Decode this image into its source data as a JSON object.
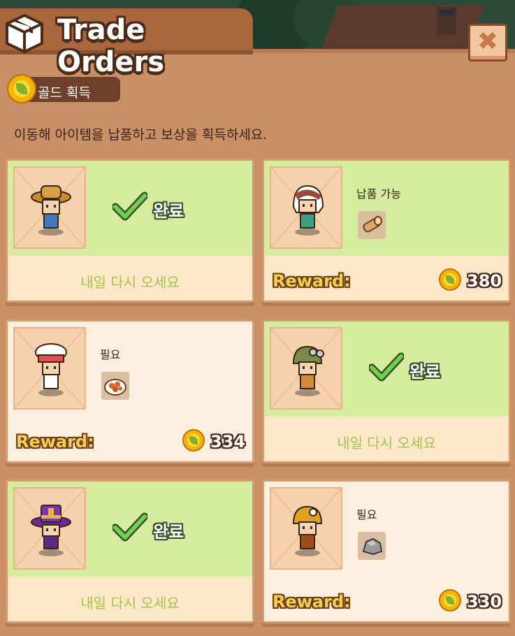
{
  "header": {
    "title": "Trade Orders",
    "title_icon": "box-icon",
    "close_icon": "close-icon",
    "close_label": "✖"
  },
  "gold_badge": {
    "label": "골드 획득",
    "icon": "gold-coin-icon"
  },
  "description": "이동해 아이템을 납품하고 보상을 획득하세요.",
  "cards": [
    {
      "state": "completed",
      "npc": "farmer-npc-icon",
      "status_text": "완료",
      "status_icon": "checkmark-icon",
      "footer_text": "내일 다시 오세요"
    },
    {
      "state": "deliverable",
      "npc": "white-hood-npc-icon",
      "requirement_label": "납품 가능",
      "item_icon": "wood-log-icon",
      "reward_label": "Reward:",
      "reward_value": "380"
    },
    {
      "state": "required",
      "npc": "chef-npc-icon",
      "requirement_label": "필요",
      "item_icon": "food-plate-icon",
      "reward_label": "Reward:",
      "reward_value": "334"
    },
    {
      "state": "completed",
      "npc": "explorer-npc-icon",
      "status_text": "완료",
      "status_icon": "checkmark-icon",
      "footer_text": "내일 다시 오세요"
    },
    {
      "state": "completed",
      "npc": "wizard-npc-icon",
      "status_text": "완료",
      "status_icon": "checkmark-icon",
      "footer_text": "내일 다시 오세요"
    },
    {
      "state": "required",
      "npc": "miner-npc-icon",
      "requirement_label": "필요",
      "item_icon": "stone-icon",
      "reward_label": "Reward:",
      "reward_value": "330"
    }
  ],
  "colors": {
    "panel_bg": "#c98f67",
    "completed_bg": "#d5ec9f",
    "card_footer_bg": "#fde7c9",
    "comeback_text": "#a4c24c",
    "reward_text": "#f6cf4a",
    "title_tab": "#a8673c"
  }
}
